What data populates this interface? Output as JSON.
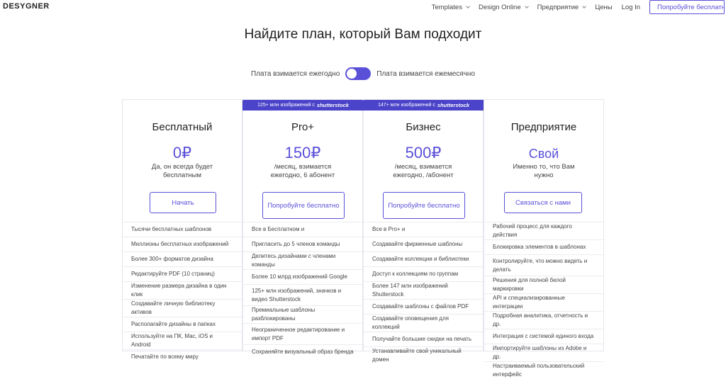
{
  "nav": {
    "logo": "DESYGNER",
    "links": [
      "Templates",
      "Design Online",
      "Предприятие",
      "Цены",
      "Log In"
    ],
    "cta": "Попробуйте бесплатно"
  },
  "title": "Найдите план, который Вам подходит",
  "toggle": {
    "left": "Плата взимается ежегодно",
    "right": "Плата взимается ежемесячно"
  },
  "cards": [
    {
      "name": "Бесплатный",
      "price": "0₽",
      "desc": "Да, он всегда будет бесплатным",
      "button": "Начать",
      "features": [
        "Тысячи бесплатных шаблонов",
        "Миллионы бесплатных изображений",
        "Более 300+ форматов дизайна",
        "Редактируйте PDF (10 страниц)",
        "Изменение размера дизайна в один клик",
        "Создавайте личную библиотеку активов",
        "Располагайте дизайны в папках",
        "Используйте на ПК, Mac, iOS и Android",
        "Печатайте по всему миру"
      ]
    },
    {
      "name": "Pro+",
      "price": "150₽",
      "desc": "/месяц, взимается ежегодно, 6 абонент",
      "button": "Попробуйте бесплатно",
      "banner": "125+ млн изображений с",
      "banner_brand": "shutterstock",
      "features": [
        "Все в Бесплатном и",
        "Пригласить до 5 членов команды",
        "Делитесь дизайнами с членами команды",
        "Более 10 млрд изображений Google",
        "125+ млн изображений, значков и видео Shutterstock",
        "Премиальные шаблоны разблокированы",
        "Неограниченное редактирование и импорт PDF",
        "Сохраняйте визуальный образ бренда"
      ]
    },
    {
      "name": "Бизнес",
      "price": "500₽",
      "desc": "/месяц, взимается ежегодно, /абонент",
      "button": "Попробуйте бесплатно",
      "banner": "147+ млн изображений с",
      "banner_brand": "shutterstock",
      "features": [
        "Все в Pro+ и",
        "Создавайте фирменные шаблоны",
        "Создавайте коллекции и библиотеки",
        "Доступ к коллекциям по группам",
        "Более 147 млн изображений Shutterstock",
        "Создавайте шаблоны с файлов PDF",
        "Создавайте оповещения для коллекций",
        "Получайте большие скидки на печать",
        "Устанавливайте свой уникальный домен"
      ]
    },
    {
      "name": "Предприятие",
      "price": "Свой",
      "desc": "Именно то, что Вам нужно",
      "button": "Связаться с нами",
      "features": [
        "Рабочий процесс для каждого действия",
        "Блокировка элементов в шаблонах",
        "Контролируйте, что можно видеть и делать",
        "Решения для полной белой маркировки",
        "API и специализированные интеграции",
        "Подробная аналитика, отчетность и др.",
        "Интеграция с системой единого входа",
        "Импортируйте шаблоны из Adobe и др.",
        "Настраиваемый пользовательский интерфейс"
      ]
    }
  ]
}
